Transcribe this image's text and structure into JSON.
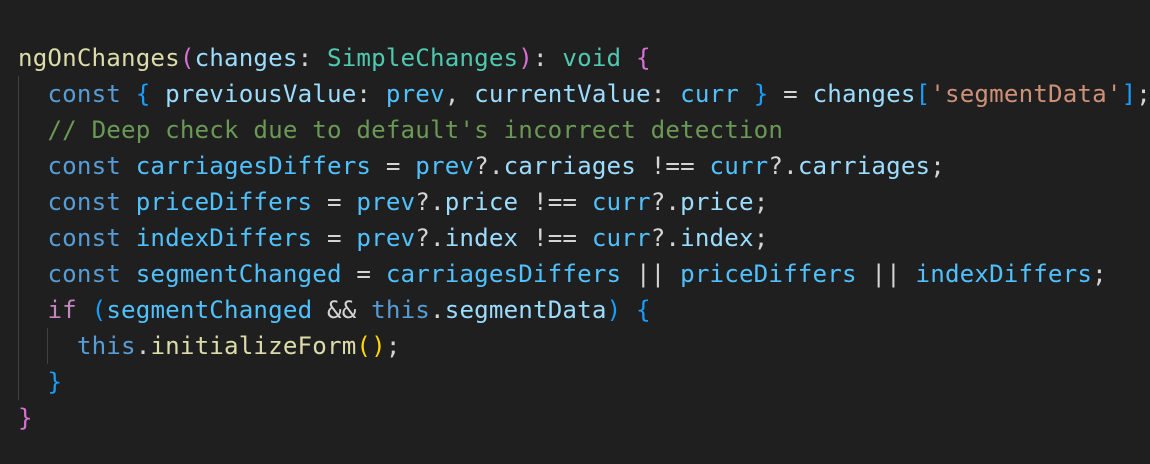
{
  "editor": {
    "colors": {
      "background": "#1f1f1f",
      "function": "#dcdcaa",
      "variable": "#9cdcfe",
      "type": "#4ec9b0",
      "keyword": "#569cd6",
      "control": "#c586c0",
      "string": "#ce9178",
      "comment": "#6a9955",
      "default": "#d4d4d4",
      "bracket_gold": "#ffd700",
      "bracket_purple": "#da70d6",
      "bracket_blue": "#179fff"
    },
    "lines": [
      {
        "indent": 0,
        "tokens": [
          {
            "t": "ngOnChanges",
            "c": "#dcdcaa"
          },
          {
            "t": "(",
            "c": "#da70d6"
          },
          {
            "t": "changes",
            "c": "#9cdcfe"
          },
          {
            "t": ": ",
            "c": "#d4d4d4"
          },
          {
            "t": "SimpleChanges",
            "c": "#4ec9b0"
          },
          {
            "t": ")",
            "c": "#da70d6"
          },
          {
            "t": ": ",
            "c": "#d4d4d4"
          },
          {
            "t": "void",
            "c": "#4ec9b0"
          },
          {
            "t": " ",
            "c": "#d4d4d4"
          },
          {
            "t": "{",
            "c": "#da70d6"
          }
        ]
      },
      {
        "indent": 1,
        "tokens": [
          {
            "t": "const",
            "c": "#569cd6"
          },
          {
            "t": " ",
            "c": "#d4d4d4"
          },
          {
            "t": "{",
            "c": "#179fff"
          },
          {
            "t": " ",
            "c": "#d4d4d4"
          },
          {
            "t": "previousValue",
            "c": "#9cdcfe"
          },
          {
            "t": ": ",
            "c": "#d4d4d4"
          },
          {
            "t": "prev",
            "c": "#4fc1ff"
          },
          {
            "t": ", ",
            "c": "#d4d4d4"
          },
          {
            "t": "currentValue",
            "c": "#9cdcfe"
          },
          {
            "t": ": ",
            "c": "#d4d4d4"
          },
          {
            "t": "curr",
            "c": "#4fc1ff"
          },
          {
            "t": " ",
            "c": "#d4d4d4"
          },
          {
            "t": "}",
            "c": "#179fff"
          },
          {
            "t": " = ",
            "c": "#d4d4d4"
          },
          {
            "t": "changes",
            "c": "#9cdcfe"
          },
          {
            "t": "[",
            "c": "#179fff"
          },
          {
            "t": "'segmentData'",
            "c": "#ce9178"
          },
          {
            "t": "]",
            "c": "#179fff"
          },
          {
            "t": ";",
            "c": "#d4d4d4"
          }
        ]
      },
      {
        "indent": 1,
        "tokens": [
          {
            "t": "// Deep check due to default's incorrect detection",
            "c": "#6a9955"
          }
        ]
      },
      {
        "indent": 1,
        "tokens": [
          {
            "t": "const",
            "c": "#569cd6"
          },
          {
            "t": " ",
            "c": "#d4d4d4"
          },
          {
            "t": "carriagesDiffers",
            "c": "#4fc1ff"
          },
          {
            "t": " = ",
            "c": "#d4d4d4"
          },
          {
            "t": "prev",
            "c": "#4fc1ff"
          },
          {
            "t": "?.",
            "c": "#d4d4d4"
          },
          {
            "t": "carriages",
            "c": "#9cdcfe"
          },
          {
            "t": " !== ",
            "c": "#d4d4d4"
          },
          {
            "t": "curr",
            "c": "#4fc1ff"
          },
          {
            "t": "?.",
            "c": "#d4d4d4"
          },
          {
            "t": "carriages",
            "c": "#9cdcfe"
          },
          {
            "t": ";",
            "c": "#d4d4d4"
          }
        ]
      },
      {
        "indent": 1,
        "tokens": [
          {
            "t": "const",
            "c": "#569cd6"
          },
          {
            "t": " ",
            "c": "#d4d4d4"
          },
          {
            "t": "priceDiffers",
            "c": "#4fc1ff"
          },
          {
            "t": " = ",
            "c": "#d4d4d4"
          },
          {
            "t": "prev",
            "c": "#4fc1ff"
          },
          {
            "t": "?.",
            "c": "#d4d4d4"
          },
          {
            "t": "price",
            "c": "#9cdcfe"
          },
          {
            "t": " !== ",
            "c": "#d4d4d4"
          },
          {
            "t": "curr",
            "c": "#4fc1ff"
          },
          {
            "t": "?.",
            "c": "#d4d4d4"
          },
          {
            "t": "price",
            "c": "#9cdcfe"
          },
          {
            "t": ";",
            "c": "#d4d4d4"
          }
        ]
      },
      {
        "indent": 1,
        "tokens": [
          {
            "t": "const",
            "c": "#569cd6"
          },
          {
            "t": " ",
            "c": "#d4d4d4"
          },
          {
            "t": "indexDiffers",
            "c": "#4fc1ff"
          },
          {
            "t": " = ",
            "c": "#d4d4d4"
          },
          {
            "t": "prev",
            "c": "#4fc1ff"
          },
          {
            "t": "?.",
            "c": "#d4d4d4"
          },
          {
            "t": "index",
            "c": "#9cdcfe"
          },
          {
            "t": " !== ",
            "c": "#d4d4d4"
          },
          {
            "t": "curr",
            "c": "#4fc1ff"
          },
          {
            "t": "?.",
            "c": "#d4d4d4"
          },
          {
            "t": "index",
            "c": "#9cdcfe"
          },
          {
            "t": ";",
            "c": "#d4d4d4"
          }
        ]
      },
      {
        "indent": 1,
        "tokens": [
          {
            "t": "const",
            "c": "#569cd6"
          },
          {
            "t": " ",
            "c": "#d4d4d4"
          },
          {
            "t": "segmentChanged",
            "c": "#4fc1ff"
          },
          {
            "t": " = ",
            "c": "#d4d4d4"
          },
          {
            "t": "carriagesDiffers",
            "c": "#4fc1ff"
          },
          {
            "t": " || ",
            "c": "#d4d4d4"
          },
          {
            "t": "priceDiffers",
            "c": "#4fc1ff"
          },
          {
            "t": " || ",
            "c": "#d4d4d4"
          },
          {
            "t": "indexDiffers",
            "c": "#4fc1ff"
          },
          {
            "t": ";",
            "c": "#d4d4d4"
          }
        ]
      },
      {
        "indent": 1,
        "tokens": [
          {
            "t": "if",
            "c": "#c586c0"
          },
          {
            "t": " ",
            "c": "#d4d4d4"
          },
          {
            "t": "(",
            "c": "#179fff"
          },
          {
            "t": "segmentChanged",
            "c": "#4fc1ff"
          },
          {
            "t": " && ",
            "c": "#d4d4d4"
          },
          {
            "t": "this",
            "c": "#569cd6"
          },
          {
            "t": ".",
            "c": "#d4d4d4"
          },
          {
            "t": "segmentData",
            "c": "#9cdcfe"
          },
          {
            "t": ")",
            "c": "#179fff"
          },
          {
            "t": " ",
            "c": "#d4d4d4"
          },
          {
            "t": "{",
            "c": "#179fff"
          }
        ]
      },
      {
        "indent": 2,
        "tokens": [
          {
            "t": "this",
            "c": "#569cd6"
          },
          {
            "t": ".",
            "c": "#d4d4d4"
          },
          {
            "t": "initializeForm",
            "c": "#dcdcaa"
          },
          {
            "t": "(",
            "c": "#ffd700"
          },
          {
            "t": ")",
            "c": "#ffd700"
          },
          {
            "t": ";",
            "c": "#d4d4d4"
          }
        ]
      },
      {
        "indent": 1,
        "tokens": [
          {
            "t": "}",
            "c": "#179fff"
          }
        ]
      },
      {
        "indent": 0,
        "tokens": [
          {
            "t": "}",
            "c": "#da70d6"
          }
        ]
      }
    ]
  }
}
